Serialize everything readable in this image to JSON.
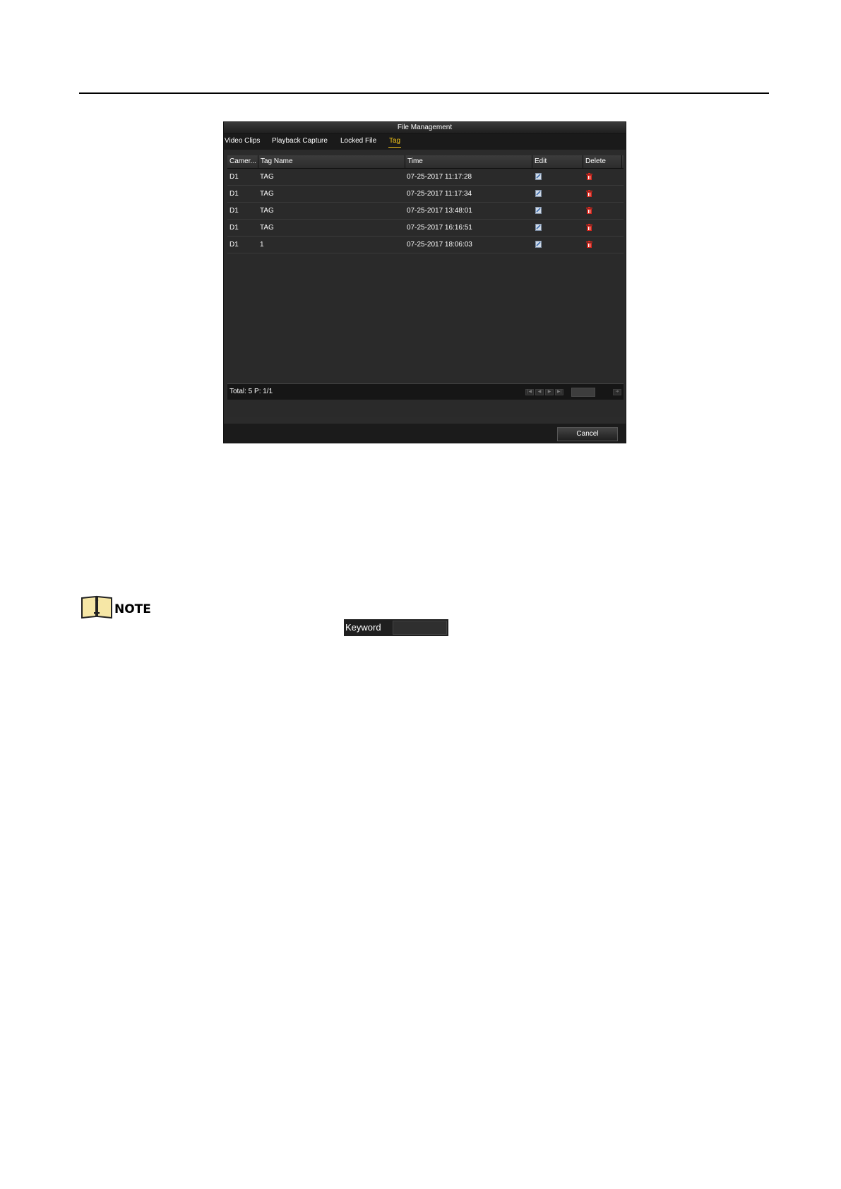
{
  "dialog": {
    "title": "File Management",
    "tabs": [
      {
        "label": "Video Clips",
        "active": false
      },
      {
        "label": "Playback Capture",
        "active": false
      },
      {
        "label": "Locked File",
        "active": false
      },
      {
        "label": "Tag",
        "active": true
      }
    ],
    "columns": [
      "Camer...",
      "Tag Name",
      "Time",
      "Edit",
      "Delete"
    ],
    "rows": [
      {
        "camera": "D1",
        "tag_name": "TAG",
        "time": "07-25-2017 11:17:28"
      },
      {
        "camera": "D1",
        "tag_name": "TAG",
        "time": "07-25-2017 11:17:34"
      },
      {
        "camera": "D1",
        "tag_name": "TAG",
        "time": "07-25-2017 13:48:01"
      },
      {
        "camera": "D1",
        "tag_name": "TAG",
        "time": "07-25-2017 16:16:51"
      },
      {
        "camera": "D1",
        "tag_name": "1",
        "time": "07-25-2017 18:06:03"
      }
    ],
    "total_text": "Total: 5 P: 1/1",
    "cancel_label": "Cancel"
  },
  "note": {
    "label": "NOTE",
    "keyword_label": "Keyword"
  },
  "colors": {
    "active_tab": "#f2c318",
    "delete_icon": "#d8261c",
    "dialog_bg": "#2b2b2b"
  }
}
